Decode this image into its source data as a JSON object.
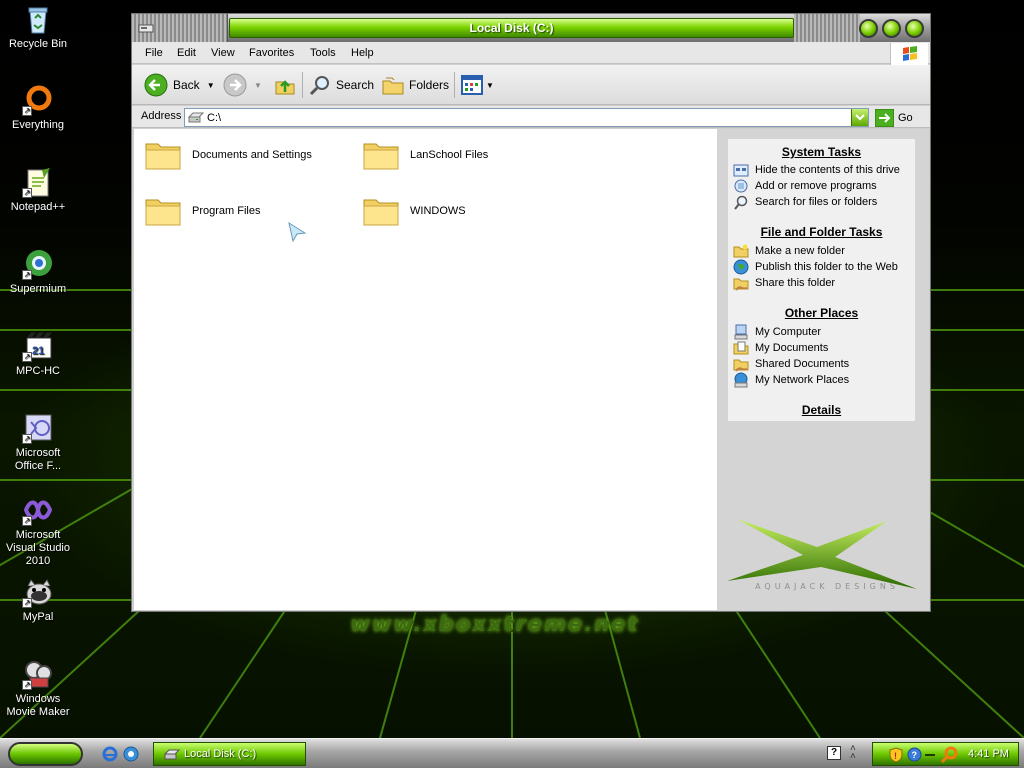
{
  "desktop": {
    "watermark": "www.xboxxtreme.net",
    "icons": [
      {
        "label": "Recycle Bin",
        "icon": "recycle-bin-icon"
      },
      {
        "label": "Everything",
        "icon": "everything-icon"
      },
      {
        "label": "Notepad++",
        "icon": "notepadpp-icon"
      },
      {
        "label": "Supermium",
        "icon": "supermium-icon"
      },
      {
        "label": "MPC-HC",
        "icon": "mpc-hc-icon"
      },
      {
        "label": "Microsoft Office F...",
        "icon": "office-icon"
      },
      {
        "label": "Microsoft Visual Studio 2010",
        "icon": "visual-studio-icon"
      },
      {
        "label": "MyPal",
        "icon": "mypal-icon"
      },
      {
        "label": "Windows Movie Maker",
        "icon": "movie-maker-icon"
      }
    ]
  },
  "window": {
    "title": "Local Disk (C:)",
    "menu": [
      "File",
      "Edit",
      "View",
      "Favorites",
      "Tools",
      "Help"
    ],
    "toolbar": {
      "back": "Back",
      "search": "Search",
      "folders": "Folders"
    },
    "address": {
      "label": "Address",
      "value": "C:\\",
      "go": "Go"
    },
    "folders": [
      "Documents and Settings",
      "LanSchool Files",
      "Program Files",
      "WINDOWS"
    ],
    "task_pane": {
      "system_tasks": {
        "title": "System Tasks",
        "items": [
          "Hide the contents of this drive",
          "Add or remove programs",
          "Search for files or folders"
        ]
      },
      "file_folder_tasks": {
        "title": "File and Folder Tasks",
        "items": [
          "Make a new folder",
          "Publish this folder to the Web",
          "Share this folder"
        ]
      },
      "other_places": {
        "title": "Other Places",
        "items": [
          "My Computer",
          "My Documents",
          "Shared Documents",
          "My Network Places"
        ]
      },
      "details": {
        "title": "Details"
      },
      "branding": "AQUAJACK DESIGNS"
    }
  },
  "taskbar": {
    "task_label": "Local Disk (C:)",
    "clock": "4:41 PM",
    "help_glyph": "?"
  },
  "colors": {
    "accent_green": "#6ec800",
    "dark_green": "#2f7400"
  }
}
